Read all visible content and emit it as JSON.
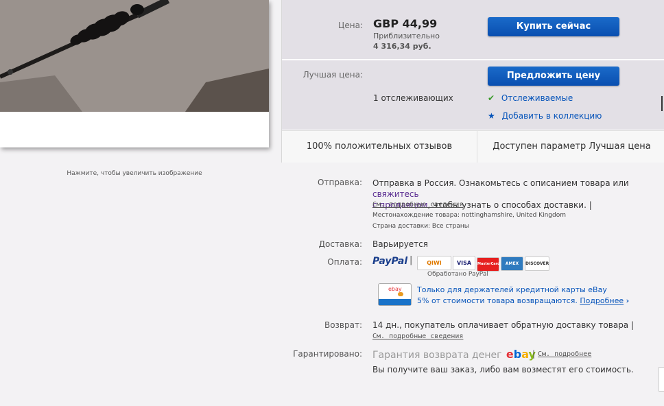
{
  "image": {
    "zoom_hint": "Нажмите, чтобы увеличить изображение"
  },
  "buy_box": {
    "price_label": "Цена:",
    "price": "GBP 44,99",
    "approx_label": "Приблизительно",
    "approx_price": "4 316,34 руб.",
    "buy_now": "Купить сейчас",
    "best_offer_label": "Лучшая цена:",
    "make_offer": "Предложить цену",
    "watchers": "1 отслеживающих",
    "watching": "Отслеживаемые",
    "add_collection": "Добавить в коллекцию",
    "feedback": "100% положительных отзывов",
    "best_offer_available": "Доступен параметр Лучшая цена"
  },
  "shipping": {
    "label": "Отправка:",
    "text_before": "Отправка в Россия. Ознакомьтесь с описанием товара или ",
    "contact_link": "свяжитесь",
    "contact_link2": "с продавцом",
    "text_after": ", чтобы узнать о способах доставки. |",
    "details_link": "См. подробные сведения",
    "location": "Местонахождение товара: nottinghamshire, United Kingdom",
    "countries": "Страна доставки: Все страны"
  },
  "delivery": {
    "label": "Доставка:",
    "value": "Варьируется"
  },
  "payment": {
    "label": "Оплата:",
    "paypal": "PayPal",
    "processed": "Обработано PayPal",
    "cards": [
      "QIWI",
      "VISA",
      "MasterCard",
      "AMEX",
      "DISCOVER"
    ],
    "promo_line1": "Только для держателей кредитной карты eBay",
    "promo_line2": "5% от стоимости товара возвращаются.",
    "promo_more": "Подробнее",
    "promo_card_brand": "ebay"
  },
  "returns": {
    "label": "Возврат:",
    "value": "14 дн., покупатель оплачивает обратную доставку товара |",
    "details_link": "См. подробные сведения"
  },
  "guarantee": {
    "label": "Гарантировано:",
    "text": "Гарантия возврата денег",
    "brand": "ebay",
    "more_link": "См. подробнее",
    "description": "Вы получите ваш заказ, либо вам возместят его стоимость."
  },
  "colors": {
    "accent": "#0654ba",
    "button": "#0a56b8",
    "panel": "#e3e0e6"
  }
}
